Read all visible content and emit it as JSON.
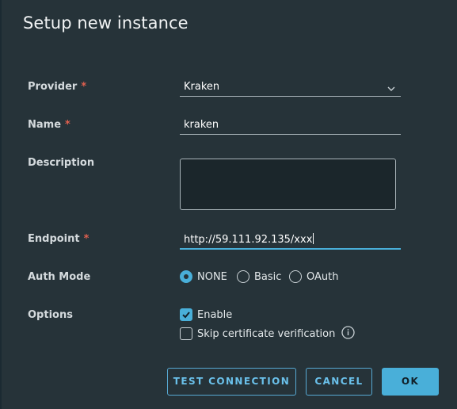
{
  "dialog": {
    "title": "Setup new instance"
  },
  "form": {
    "provider": {
      "label": "Provider",
      "required": "*",
      "value": "Kraken"
    },
    "name": {
      "label": "Name",
      "required": "*",
      "value": "kraken"
    },
    "description": {
      "label": "Description",
      "value": ""
    },
    "endpoint": {
      "label": "Endpoint",
      "required": "*",
      "value": "http://59.111.92.135/xxx"
    },
    "auth_mode": {
      "label": "Auth Mode",
      "options": [
        {
          "label": "NONE",
          "selected": true
        },
        {
          "label": "Basic",
          "selected": false
        },
        {
          "label": "OAuth",
          "selected": false
        }
      ]
    },
    "options": {
      "label": "Options",
      "enable": {
        "label": "Enable",
        "checked": true
      },
      "skip_cert": {
        "label": "Skip certificate verification",
        "checked": false
      }
    }
  },
  "buttons": {
    "test_connection": "TEST CONNECTION",
    "cancel": "CANCEL",
    "ok": "OK"
  },
  "colors": {
    "background": "#263339",
    "accent": "#49afd9",
    "required": "#e0604f"
  },
  "icons": {
    "dropdown": "chevron-down-icon",
    "checkmark": "check-icon",
    "info": "info-icon"
  }
}
